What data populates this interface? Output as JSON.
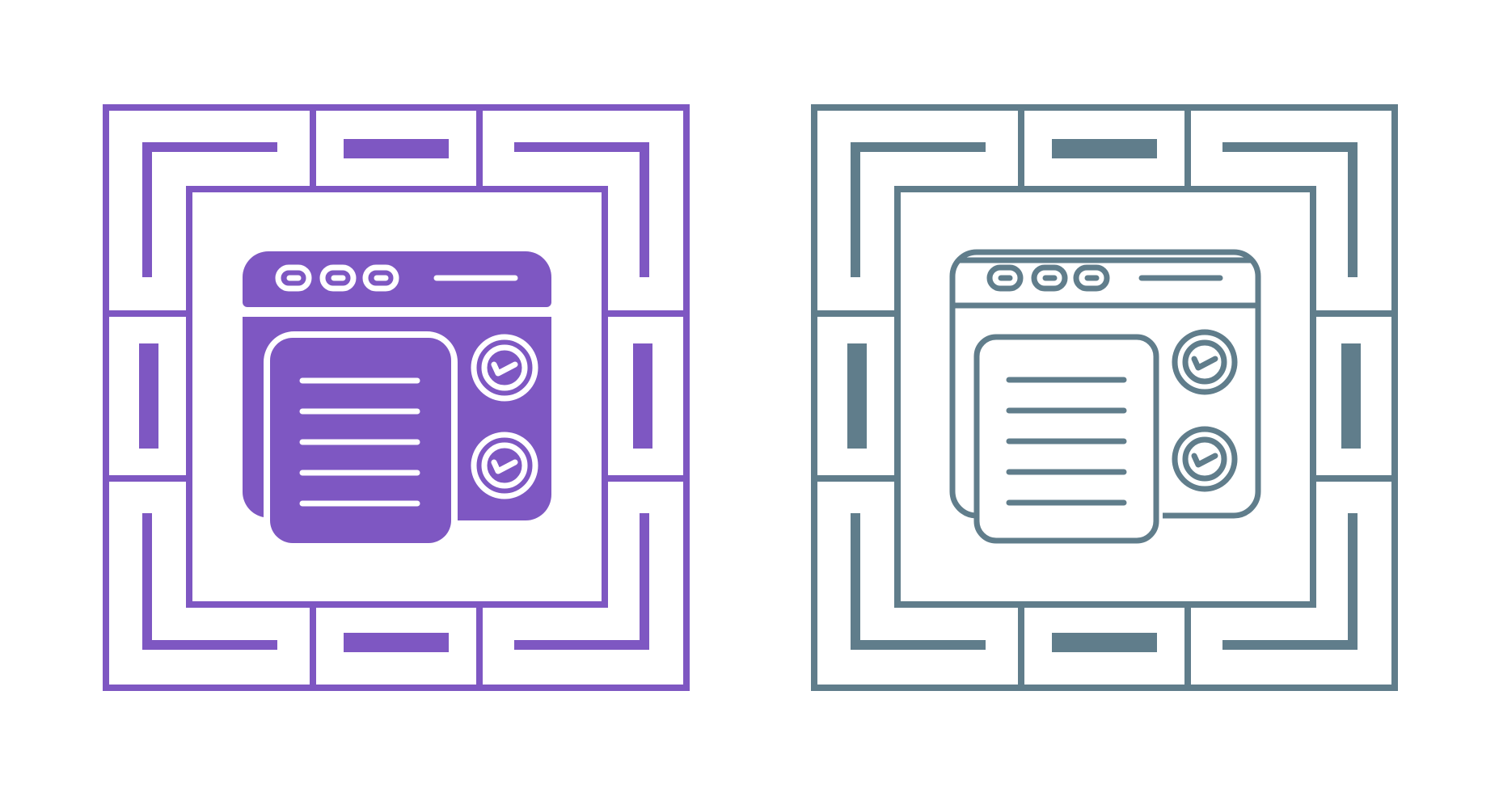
{
  "icons": [
    {
      "id": "filled",
      "name": "browser-checklist-filled-icon",
      "style": "glyph",
      "color": "#7e57c2"
    },
    {
      "id": "outline",
      "name": "browser-checklist-outline-icon",
      "style": "line",
      "color": "#607d8b"
    }
  ],
  "background_color": "#ffffff"
}
